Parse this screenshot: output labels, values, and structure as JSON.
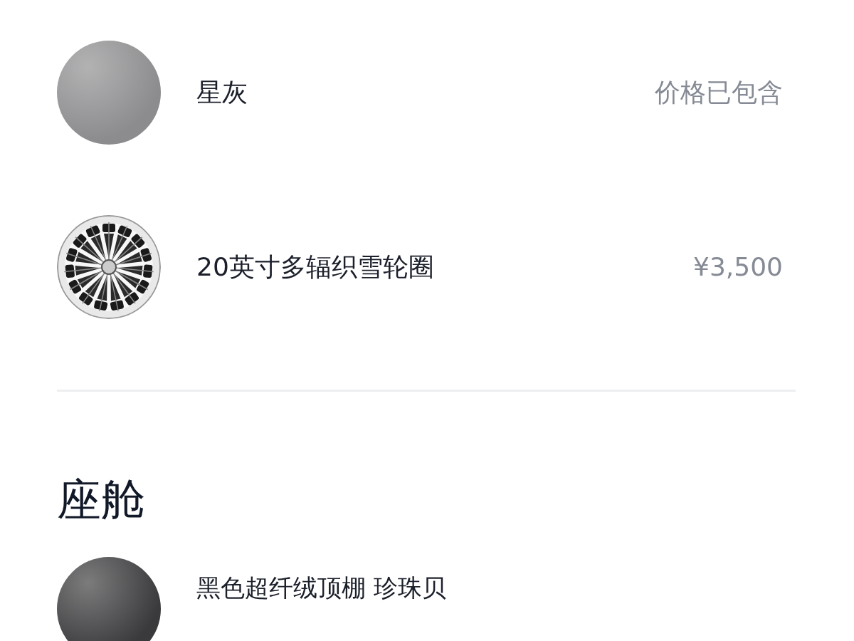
{
  "exterior_options": [
    {
      "kind": "swatch",
      "color": "#8c8c8e",
      "name": "星灰",
      "price": "价格已包含"
    },
    {
      "kind": "wheel",
      "name": "20英寸多辐织雪轮圈",
      "price": "¥3,500"
    }
  ],
  "cabin": {
    "heading": "座舱",
    "options": [
      {
        "kind": "swatch",
        "color": "#3a3a3c",
        "name": "黑色超纤绒顶棚 珍珠贝"
      }
    ]
  }
}
